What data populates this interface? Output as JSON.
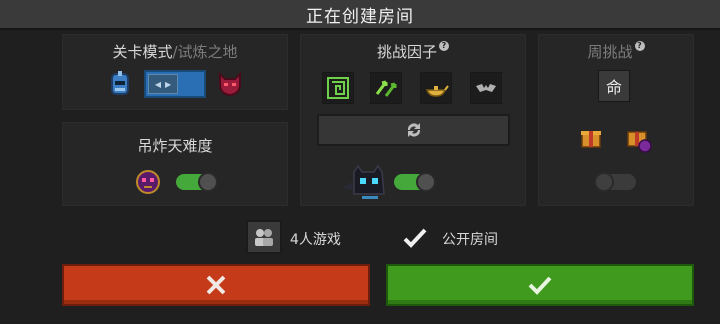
{
  "dialog": {
    "title": "正在创建房间"
  },
  "level_mode": {
    "title_main": "关卡模式",
    "title_sep": "/",
    "title_alt": "试炼之地",
    "left_icon": "knight-helmet-icon",
    "right_icon": "demon-mask-icon",
    "switch_state": "left"
  },
  "hard_mode": {
    "title": "吊炸天难度",
    "icon": "demon-skull-icon",
    "enabled": true
  },
  "challenge_factors": {
    "title": "挑战因子",
    "help": "?",
    "factors": [
      {
        "icon": "green-maze-icon"
      },
      {
        "icon": "green-arrows-icon"
      },
      {
        "icon": "magic-lamp-icon"
      },
      {
        "icon": "bat-icon"
      }
    ],
    "refresh_icon": "refresh-icon",
    "pet_icon": "black-cat-icon",
    "pet_enabled": true
  },
  "weekly_challenge": {
    "title": "周挑战",
    "help": "?",
    "badge_char": "命",
    "gift_icons": [
      "gift-box-icon",
      "gift-box-purple-icon"
    ],
    "enabled": false
  },
  "options": {
    "players_label": "4人游戏",
    "public_label": "公开房间",
    "public_checked": true
  },
  "buttons": {
    "cancel_icon": "close-icon",
    "confirm_icon": "checkmark-icon"
  },
  "colors": {
    "cancel": "#c53a18",
    "confirm": "#3f9a1e",
    "toggle_on": "#45a83a",
    "mode_switch": "#2a6fb4"
  }
}
